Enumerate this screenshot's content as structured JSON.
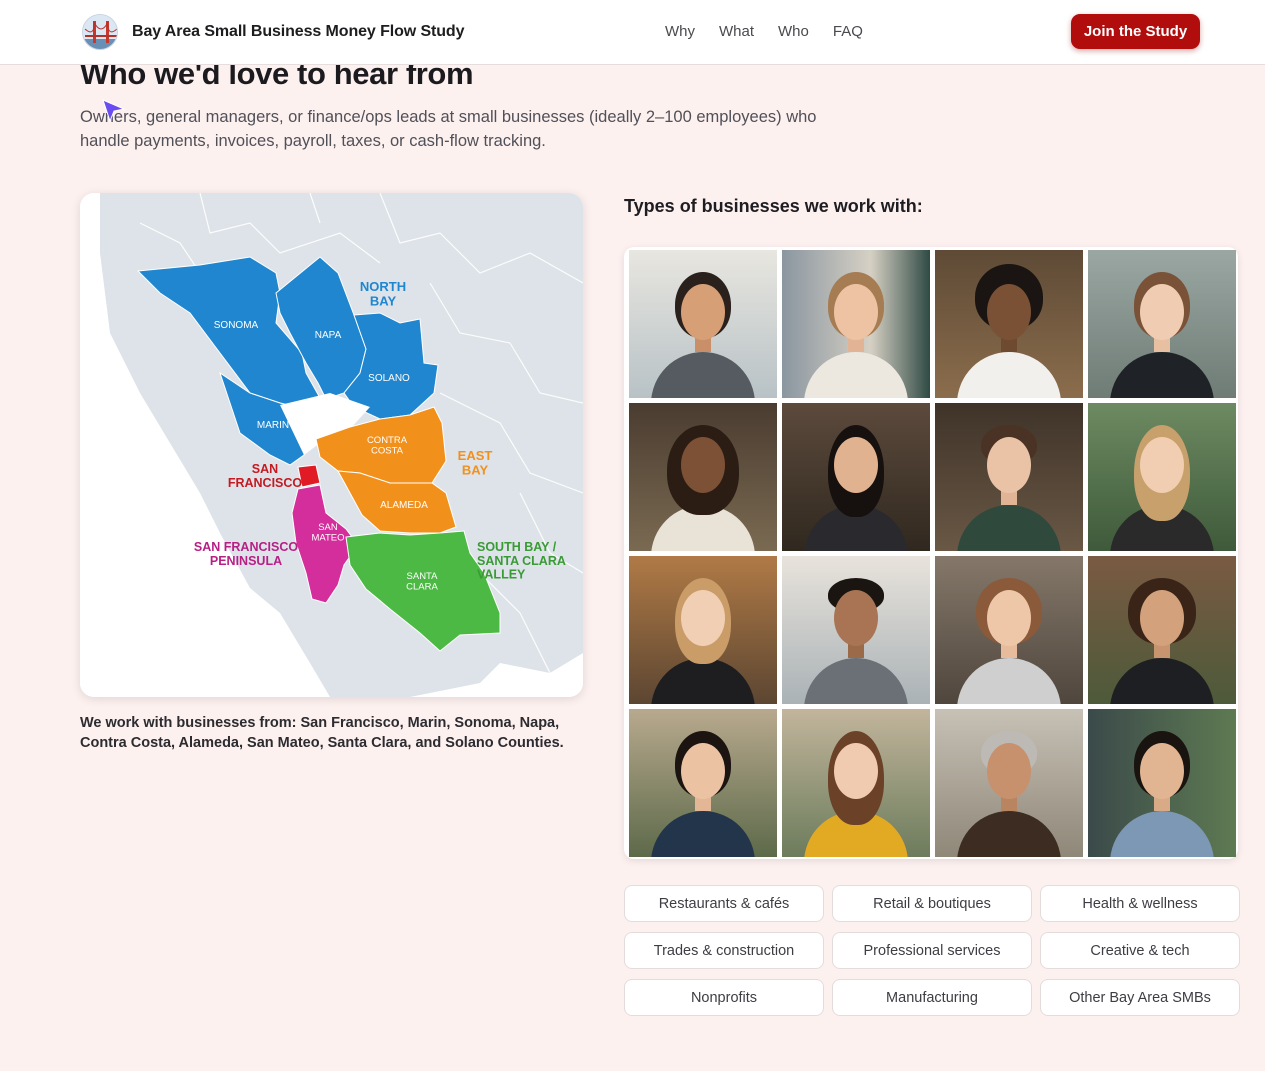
{
  "header": {
    "brand_title": "Bay Area Small Business Money Flow Study",
    "logo_icon": "golden-gate-bridge-icon",
    "nav": [
      "Why",
      "What",
      "Who",
      "FAQ"
    ],
    "cta_label": "Join the Study",
    "cta_color": "#b10d0d"
  },
  "section": {
    "title": "Who we'd love to hear from",
    "lead": "Owners, general managers, or finance/ops leads at small businesses (ideally 2–100 employees) who handle payments, invoices, payroll, taxes, or cash-flow tracking."
  },
  "map": {
    "regions": {
      "north_bay": "NORTH BAY",
      "east_bay": "EAST BAY",
      "san_francisco": "SAN FRANCISCO",
      "peninsula": "SAN FRANCISCO PENINSULA",
      "south_bay": "SOUTH BAY / SANTA CLARA VALLEY"
    },
    "counties": {
      "sonoma": "SONOMA",
      "napa": "NAPA",
      "solano": "SOLANO",
      "marin": "MARIN",
      "contra_costa": "CONTRA COSTA",
      "alameda": "ALAMEDA",
      "san_mateo": "SAN MATEO",
      "santa_clara": "SANTA CLARA"
    },
    "colors": {
      "north_bay": "#1f86cf",
      "east_bay": "#f2901c",
      "san_francisco": "#e01b25",
      "peninsula": "#d42d9c",
      "south_bay": "#4cb944",
      "background_land": "#dde3e8",
      "water": "#ffffff"
    },
    "caption": "We work with businesses from: San Francisco, Marin, Sonoma, Napa, Contra Costa, Alameda, San Mateo, Santa Clara, and Solano Counties."
  },
  "types_title": "Types of businesses we work with:",
  "portraits_count_label": "",
  "tags": [
    "Restaurants & cafés",
    "Retail & boutiques",
    "Health & wellness",
    "Trades & construction",
    "Professional services",
    "Creative & tech",
    "Nonprofits",
    "Manufacturing",
    "Other Bay Area SMBs"
  ]
}
